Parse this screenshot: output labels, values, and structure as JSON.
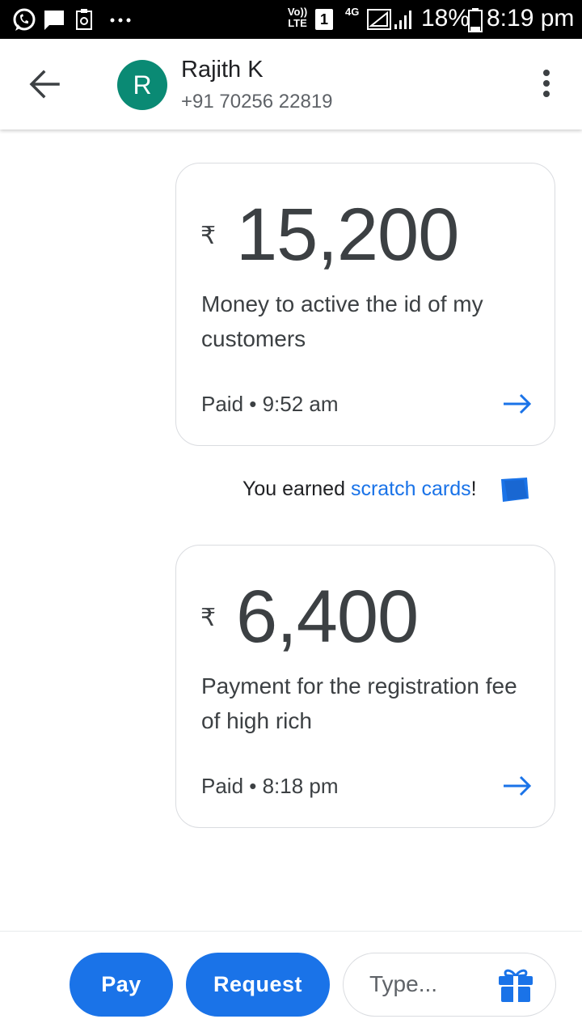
{
  "status_bar": {
    "network_label": "Vo)) LTE",
    "sim_slot": "1",
    "network_type": "4G",
    "battery": "18%",
    "time": "8:19 pm"
  },
  "header": {
    "avatar_letter": "R",
    "contact_name": "Rajith K",
    "contact_phone": "+91 70256 22819"
  },
  "payments": [
    {
      "currency_symbol": "₹",
      "amount": "15,200",
      "note": "Money to active the id of my customers",
      "status": "Paid • 9:52 am"
    },
    {
      "currency_symbol": "₹",
      "amount": "6,400",
      "note": "Payment for  the registration fee of high rich",
      "status": "Paid • 8:18 pm"
    }
  ],
  "reward": {
    "prefix": "You earned ",
    "link": "scratch cards",
    "suffix": "!"
  },
  "bottom_bar": {
    "pay_label": "Pay",
    "request_label": "Request",
    "input_placeholder": "Type..."
  },
  "colors": {
    "accent": "#1a73e8",
    "avatar": "#0a8a74"
  }
}
